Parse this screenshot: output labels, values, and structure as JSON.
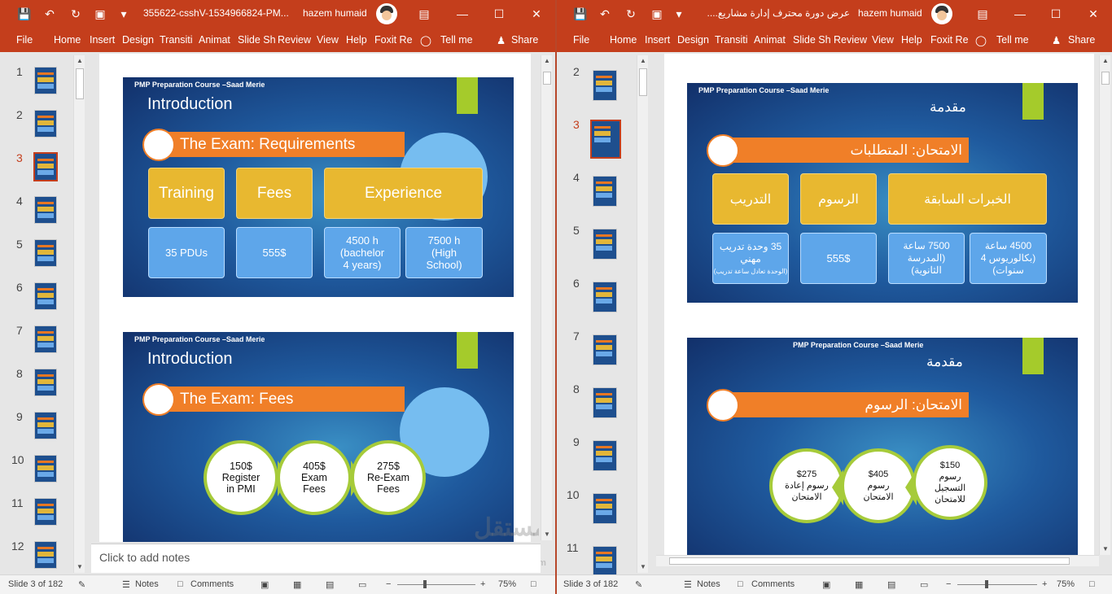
{
  "left": {
    "title": "355622-csshV-1534966824-PM...",
    "user": "hazem humaid",
    "menu": [
      "File",
      "Home",
      "Insert",
      "Design",
      "Transiti",
      "Animat",
      "Slide Sh",
      "Review",
      "View",
      "Help",
      "Foxit Re",
      "Tell me",
      "Share"
    ],
    "thumb_numbers": [
      "1",
      "2",
      "3",
      "4",
      "5",
      "6",
      "7",
      "8",
      "9",
      "10",
      "11",
      "12"
    ],
    "slide1": {
      "course": "PMP Preparation Course –Saad Merie",
      "intro": "Introduction",
      "heading": "The Exam: Requirements",
      "yellow": [
        "Training",
        "Fees",
        "Experience"
      ],
      "blue": [
        "35 PDUs",
        "555$",
        "4500 h\n(bachelor\n4 years)",
        "7500 h\n(High\nSchool)"
      ]
    },
    "slide2": {
      "course": "PMP Preparation Course –Saad Merie",
      "intro": "Introduction",
      "heading": "The Exam: Fees",
      "fees": [
        "150$\nRegister\nin PMI",
        "405$\nExam\nFees",
        "275$\nRe-Exam\nFees"
      ]
    },
    "notes": "Click to add notes",
    "status": {
      "slide": "Slide 3 of 182",
      "notes": "Notes",
      "comments": "Comments",
      "zoom": "75%"
    }
  },
  "right": {
    "title": "عرض دورة محترف إدارة مشاريع....",
    "user": "hazem humaid",
    "menu": [
      "File",
      "Home",
      "Insert",
      "Design",
      "Transiti",
      "Animat",
      "Slide Sh",
      "Review",
      "View",
      "Help",
      "Foxit Re",
      "Tell me",
      "Share"
    ],
    "thumb_numbers": [
      "2",
      "3",
      "4",
      "5",
      "6",
      "7",
      "8",
      "9",
      "10",
      "11"
    ],
    "slide1": {
      "course": "PMP Preparation Course –Saad Merie",
      "intro": "مقدمة",
      "heading": "الامتحان: المتطلبات",
      "yellow": [
        "التدريب",
        "الرسوم",
        "الخبرات السابقة"
      ],
      "blue": [
        "35 وحدة تدريب\nمهني",
        "(الوحدة تعادل ساعة تدريب)",
        "555$",
        "7500 ساعة\n(المدرسة\nالثانوية)",
        "4500 ساعة\n(بكالوريوس 4\nسنوات)"
      ]
    },
    "slide2": {
      "course": "PMP Preparation Course –Saad Merie",
      "intro": "مقدمة",
      "heading": "الامتحان: الرسوم",
      "fees": [
        "$275\nرسوم إعادة\nالامتحان",
        "$405\nرسوم\nالامتحان",
        "$150\nرسوم\nالتسجيل\nللامتحان"
      ]
    },
    "status": {
      "slide": "Slide 3 of 182",
      "notes": "Notes",
      "comments": "Comments",
      "zoom": "75%"
    }
  },
  "watermark": {
    "arabic": "مستقل",
    "latin": "mostaql.com"
  },
  "colors": {
    "accent": "#c43e1c",
    "orange": "#f07f28",
    "yellow": "#e8b830",
    "blue": "#5ea6ea",
    "green": "#a5cb2b"
  },
  "icons": [
    "save-icon",
    "undo-icon",
    "redo-icon",
    "present-icon",
    "customize-icon",
    "restore-icon",
    "minimize-icon",
    "maximize-icon",
    "close-icon",
    "lightbulb-icon",
    "share-person-icon"
  ]
}
